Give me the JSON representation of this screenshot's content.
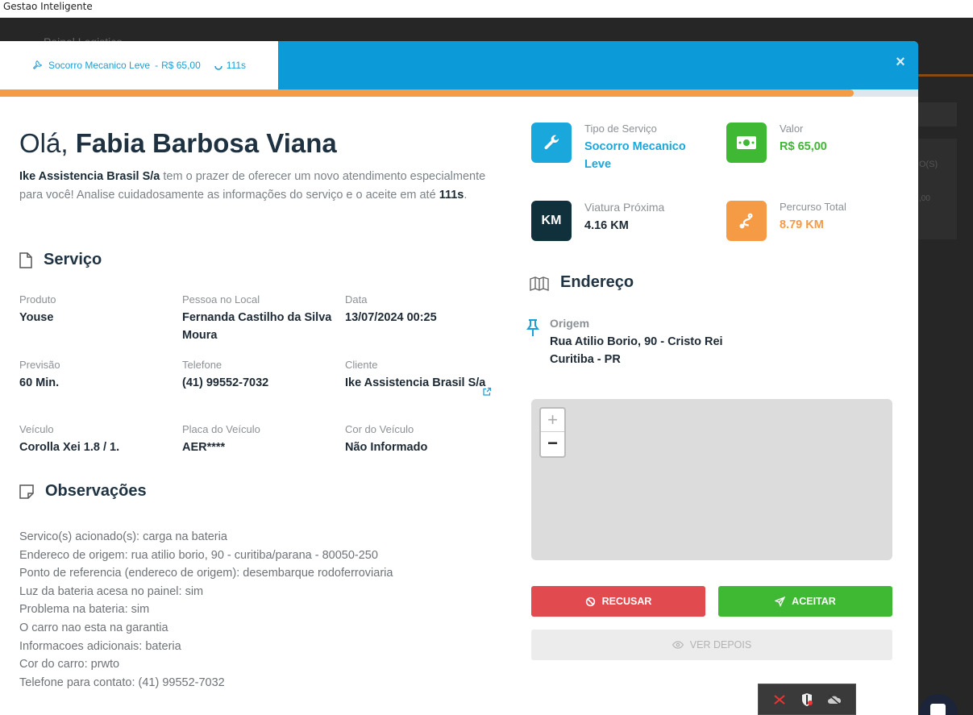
{
  "window": {
    "title": "Gestao Inteligente"
  },
  "background": {
    "panel_title": "Painel Logistico",
    "right_text_1": "O(S)",
    "right_text_2": ",00"
  },
  "header": {
    "tab": {
      "service": "Socorro Mecanico Leve",
      "sep": "-",
      "price": "R$ 65,00",
      "timer": "111s"
    },
    "close_label": "×",
    "progress_percent": 93
  },
  "greeting": {
    "prefix": "Olá, ",
    "name": "Fabia Barbosa Viana"
  },
  "intro": {
    "company": "Ike Assistencia Brasil S/a",
    "text": " tem o prazer de oferecer um novo atendimento especialmente para você! Analise cuidadosamente as informações do serviço e o aceite em até ",
    "time": "111s",
    "end": "."
  },
  "service": {
    "title": "Serviço",
    "fields": [
      {
        "label": "Produto",
        "value": "Youse"
      },
      {
        "label": "Pessoa no Local",
        "value": "Fernanda Castilho da Silva Moura"
      },
      {
        "label": "Data",
        "value": "13/07/2024 00:25"
      },
      {
        "label": "Previsão",
        "value": "60 Min."
      },
      {
        "label": "Telefone",
        "value": "(41) 99552-7032"
      },
      {
        "label": "Cliente",
        "value": "Ike Assistencia Brasil S/a"
      },
      {
        "label": "Veículo",
        "value": "Corolla Xei 1.8 / 1."
      },
      {
        "label": "Placa do Veículo",
        "value": "AER****"
      },
      {
        "label": "Cor do Veículo",
        "value": "Não Informado"
      }
    ]
  },
  "observations": {
    "title": "Observações",
    "lines": [
      "Servico(s) acionado(s): carga na bateria",
      "Endereco de origem: rua atilio borio, 90 - curitiba/parana - 80050-250",
      "Ponto de referencia (endereco de origem): desembarque rodoferroviaria",
      "Luz da bateria acesa no painel: sim",
      "Problema na bateria: sim",
      "O carro nao esta na garantia",
      "Informacoes adicionais: bateria",
      "Cor do carro: prwto",
      "Telefone para contato: (41) 99552-7032"
    ]
  },
  "kpis": {
    "service_type": {
      "label": "Tipo de Serviço",
      "value": "Socorro Mecanico Leve",
      "color": "#1aa7dc"
    },
    "value": {
      "label": "Valor",
      "value": "R$ 65,00",
      "color": "#3fb833"
    },
    "nearby": {
      "label": "Viatura Próxima",
      "value": "4.16 KM",
      "badge": "KM",
      "color": "#10303b"
    },
    "route": {
      "label": "Percurso Total",
      "value": "8.79 KM",
      "color": "#f59a45"
    }
  },
  "address": {
    "title": "Endereço",
    "origin_label": "Origem",
    "origin_line1": "Rua Atilio Borio, 90 - Cristo Rei",
    "origin_line2": "Curitiba - PR"
  },
  "map": {
    "zoom_in": "+",
    "zoom_out": "−"
  },
  "actions": {
    "refuse": "RECUSAR",
    "accept": "ACEITAR",
    "later": "VER DEPOIS"
  }
}
